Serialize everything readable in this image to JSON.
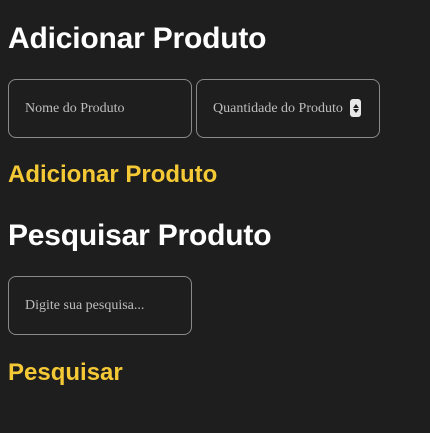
{
  "add_section": {
    "title": "Adicionar Produto",
    "name_input": {
      "placeholder": "Nome do Produto",
      "value": ""
    },
    "quantity_input": {
      "placeholder": "Quantidade do Produto",
      "value": ""
    },
    "submit_label": "Adicionar Produto"
  },
  "search_section": {
    "title": "Pesquisar Produto",
    "search_input": {
      "placeholder": "Digite sua pesquisa...",
      "value": ""
    },
    "submit_label": "Pesquisar"
  },
  "colors": {
    "background": "#1e1e1e",
    "heading": "#ffffff",
    "accent": "#f5c936",
    "input_border": "#8a8a8a"
  },
  "icons": {
    "quantity_spinner": "number-spinner-icon"
  }
}
